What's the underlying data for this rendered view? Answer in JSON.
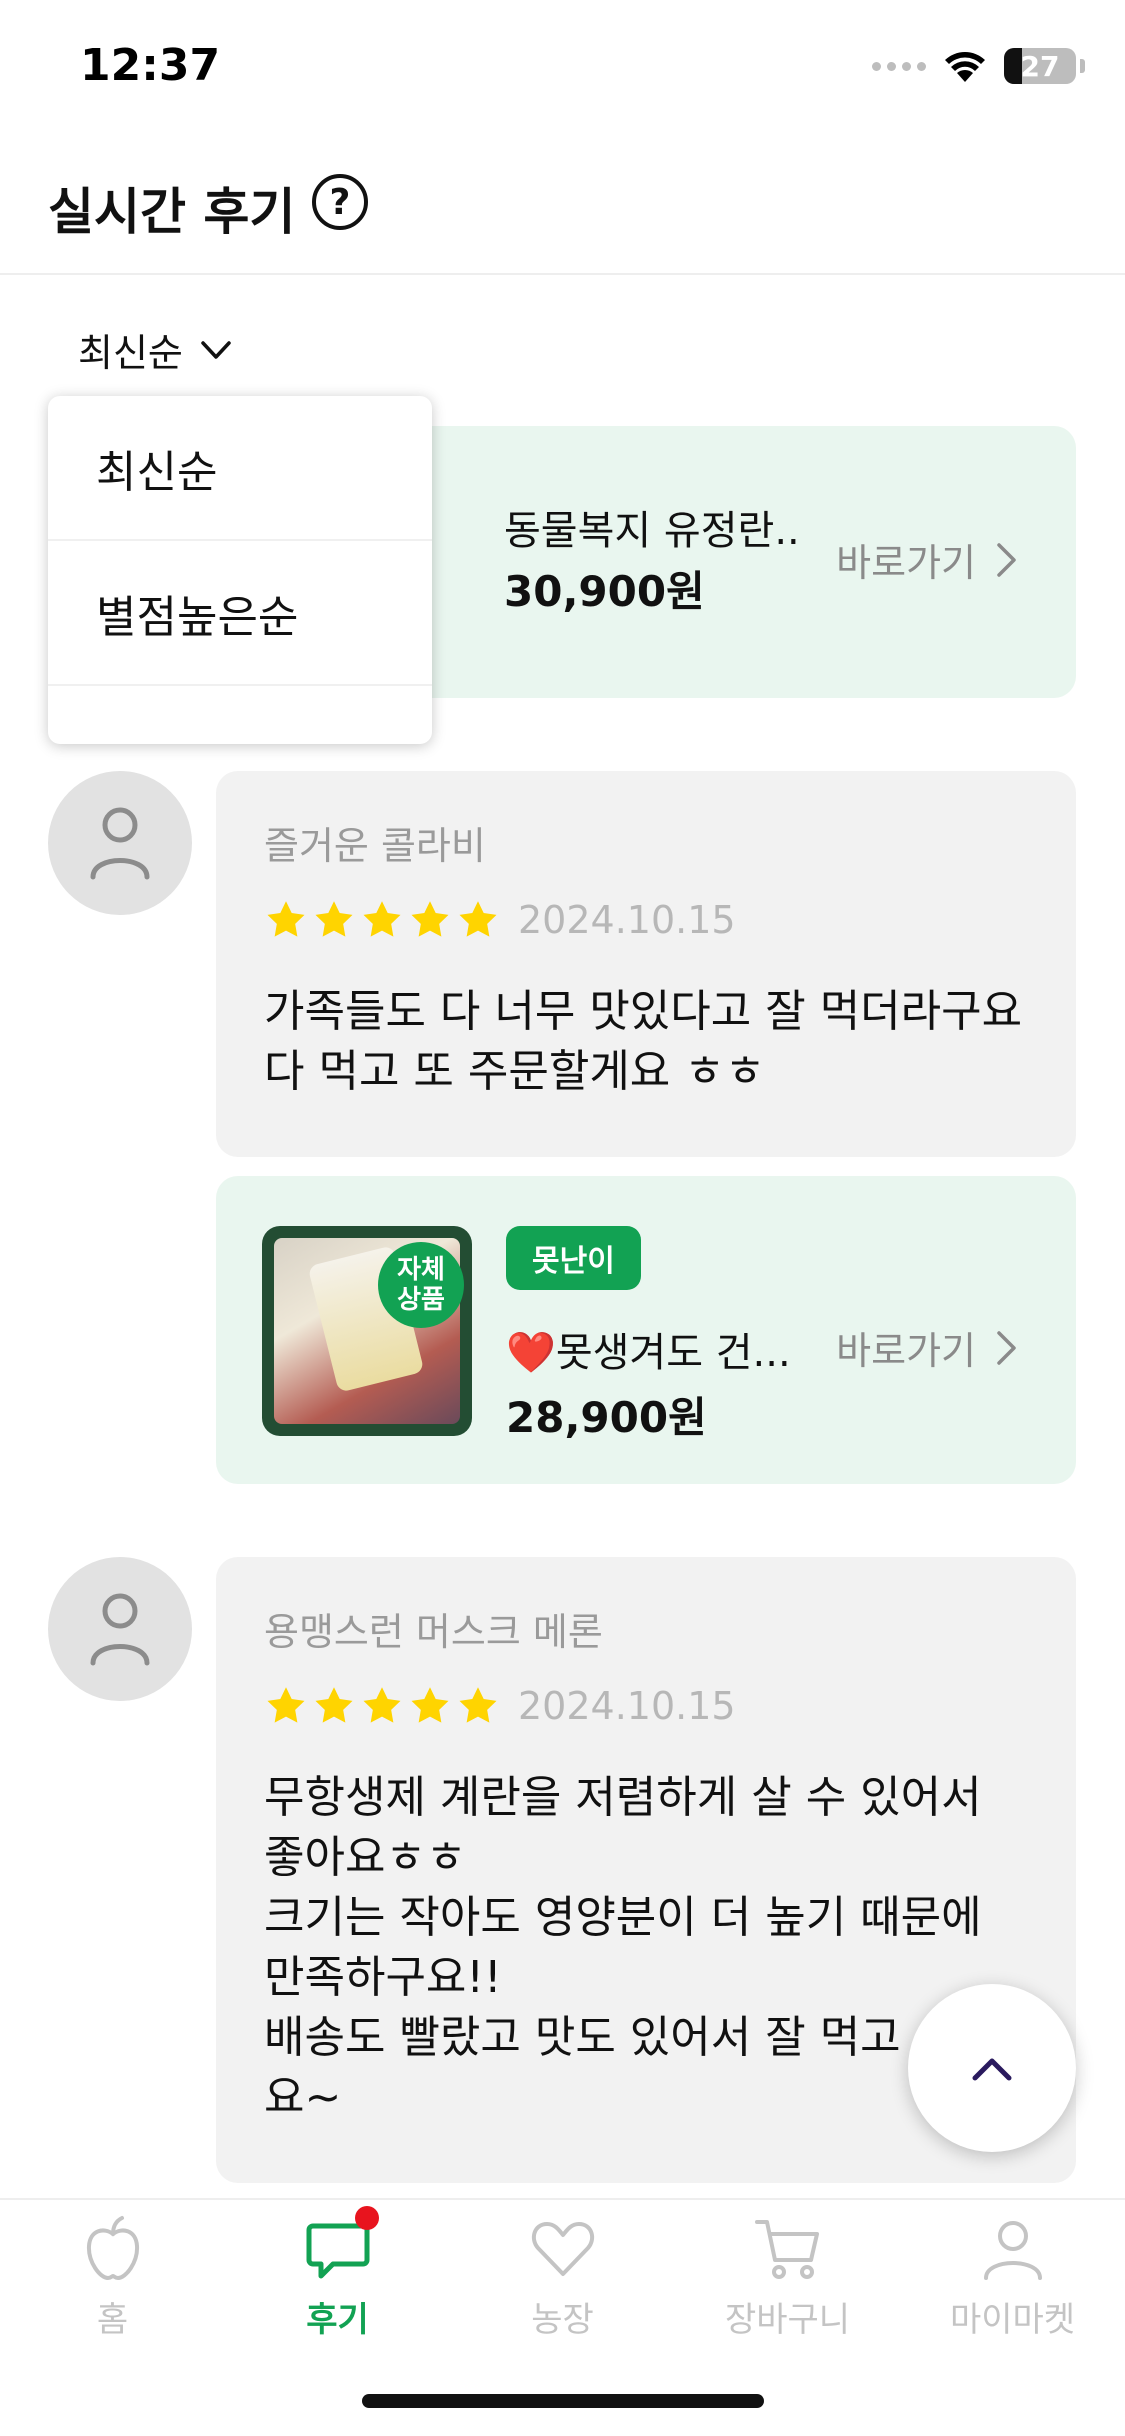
{
  "status_bar": {
    "time": "12:37",
    "battery": "27"
  },
  "header": {
    "title": "실시간 후기",
    "help_icon": "question-circle-icon"
  },
  "sort": {
    "selected": "최신순",
    "options": [
      "최신순",
      "별점높은순"
    ]
  },
  "products": [
    {
      "name": "동물복지 유정란...",
      "price": "30,900원",
      "link_label": "바로가기"
    },
    {
      "tag": "못난이",
      "badge": "자체\n상품",
      "heart": "❤️",
      "name": "못생겨도 건...",
      "price": "28,900원",
      "link_label": "바로가기"
    }
  ],
  "reviews": [
    {
      "name": "즐거운 콜라비",
      "rating": 5,
      "date": "2024.10.15",
      "text": "가족들도 다 너무 맛있다고 잘 먹더라구요\n다 먹고 또 주문할게요 ㅎㅎ"
    },
    {
      "name": "용맹스런 머스크 메론",
      "rating": 5,
      "date": "2024.10.15",
      "text": "무항생제 계란을 저렴하게 살 수 있어서\n좋아요ㅎㅎ\n크기는 작아도 영양분이 더 높기 때문에\n만족하구요!!\n배송도 빨랐고 맛도 있어서 잘 먹고\n요~"
    }
  ],
  "bottom_nav": [
    {
      "label": "홈",
      "icon": "apple-icon",
      "active": false
    },
    {
      "label": "후기",
      "icon": "chat-icon",
      "active": true
    },
    {
      "label": "농장",
      "icon": "heart-icon",
      "active": false
    },
    {
      "label": "장바구니",
      "icon": "cart-icon",
      "active": false
    },
    {
      "label": "마이마켓",
      "icon": "user-icon",
      "active": false
    }
  ],
  "colors": {
    "brand_green": "#12a253",
    "product_card_bg": "#e9f6ef",
    "review_card_bg": "#f2f2f2",
    "star": "#ffd400",
    "notification_dot": "#e8141e"
  }
}
